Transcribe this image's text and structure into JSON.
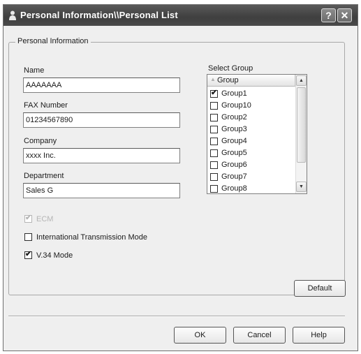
{
  "window": {
    "title": "Personal Information\\\\Personal List",
    "help_button": "?",
    "close_button": "✕"
  },
  "section": {
    "title": "Personal Information"
  },
  "fields": {
    "name": {
      "label": "Name",
      "value": "AAAAAAA"
    },
    "fax": {
      "label": "FAX Number",
      "value": "01234567890"
    },
    "company": {
      "label": "Company",
      "value": "xxxx Inc."
    },
    "department": {
      "label": "Department",
      "value": "Sales G"
    }
  },
  "select_group": {
    "label": "Select Group",
    "column_header": "Group",
    "items": [
      {
        "label": "Group1",
        "checked": true
      },
      {
        "label": "Group10",
        "checked": false
      },
      {
        "label": "Group2",
        "checked": false
      },
      {
        "label": "Group3",
        "checked": false
      },
      {
        "label": "Group4",
        "checked": false
      },
      {
        "label": "Group5",
        "checked": false
      },
      {
        "label": "Group6",
        "checked": false
      },
      {
        "label": "Group7",
        "checked": false
      },
      {
        "label": "Group8",
        "checked": false
      }
    ]
  },
  "options": {
    "ecm": {
      "label": "ECM",
      "checked": true,
      "enabled": false
    },
    "international": {
      "label": "International Transmission Mode",
      "checked": false,
      "enabled": true
    },
    "v34": {
      "label": "V.34 Mode",
      "checked": true,
      "enabled": true
    }
  },
  "buttons": {
    "default": "Default",
    "ok": "OK",
    "cancel": "Cancel",
    "help": "Help"
  }
}
